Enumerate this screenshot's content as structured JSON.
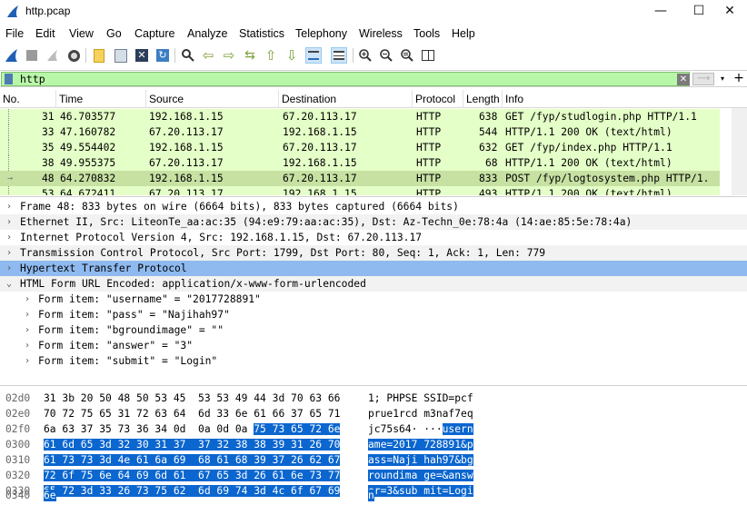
{
  "window": {
    "title": "http.pcap",
    "minimize": "—",
    "maximize": "☐",
    "close": "✕"
  },
  "menu": [
    "File",
    "Edit",
    "View",
    "Go",
    "Capture",
    "Analyze",
    "Statistics",
    "Telephony",
    "Wireless",
    "Tools",
    "Help"
  ],
  "toolbar": [
    "shark-fin-start-icon",
    "stop-capture-icon",
    "restart-capture-icon",
    "capture-options-icon",
    "open-file-icon",
    "save-file-icon",
    "close-file-icon",
    "reload-icon",
    "find-packet-icon",
    "go-back-icon",
    "go-forward-icon",
    "go-to-packet-icon",
    "go-first-icon",
    "go-last-icon",
    "auto-scroll-icon",
    "colorize-icon",
    "zoom-in-icon",
    "zoom-out-icon",
    "zoom-reset-icon",
    "resize-columns-icon"
  ],
  "filter": {
    "value": "http",
    "clear": "✕",
    "apply": "⟶",
    "dropdown": "▾",
    "add": "+"
  },
  "packet_list": {
    "columns": [
      "No.",
      "Time",
      "Source",
      "Destination",
      "Protocol",
      "Length",
      "Info"
    ],
    "rows": [
      {
        "no": "31",
        "time": "46.703577",
        "src": "192.168.1.15",
        "dst": "67.20.113.17",
        "proto": "HTTP",
        "len": "638",
        "info": "GET /fyp/studlogin.php HTTP/1.1"
      },
      {
        "no": "33",
        "time": "47.160782",
        "src": "67.20.113.17",
        "dst": "192.168.1.15",
        "proto": "HTTP",
        "len": "544",
        "info": "HTTP/1.1 200 OK  (text/html)"
      },
      {
        "no": "35",
        "time": "49.554402",
        "src": "192.168.1.15",
        "dst": "67.20.113.17",
        "proto": "HTTP",
        "len": "632",
        "info": "GET /fyp/index.php HTTP/1.1"
      },
      {
        "no": "38",
        "time": "49.955375",
        "src": "67.20.113.17",
        "dst": "192.168.1.15",
        "proto": "HTTP",
        "len": "68",
        "info": "HTTP/1.1 200 OK  (text/html)"
      },
      {
        "no": "48",
        "time": "64.270832",
        "src": "192.168.1.15",
        "dst": "67.20.113.17",
        "proto": "HTTP",
        "len": "833",
        "info": "POST /fyp/logtosystem.php HTTP/1."
      },
      {
        "no": "53",
        "time": "64.672411",
        "src": "67.20.113.17",
        "dst": "192.168.1.15",
        "proto": "HTTP",
        "len": "493",
        "info": "HTTP/1.1 200 OK  (text/html)"
      }
    ]
  },
  "details": {
    "frame": "Frame 48: 833 bytes on wire (6664 bits), 833 bytes captured (6664 bits)",
    "ethernet": "Ethernet II, Src: LiteonTe_aa:ac:35 (94:e9:79:aa:ac:35), Dst: Az-Techn_0e:78:4a (14:ae:85:5e:78:4a)",
    "ip": "Internet Protocol Version 4, Src: 192.168.1.15, Dst: 67.20.113.17",
    "tcp": "Transmission Control Protocol, Src Port: 1799, Dst Port: 80, Seq: 1, Ack: 1, Len: 779",
    "http": "Hypertext Transfer Protocol",
    "form": "HTML Form URL Encoded: application/x-www-form-urlencoded",
    "form_items": [
      "Form item: \"username\" = \"2017728891\"",
      "Form item: \"pass\" = \"Najihah97\"",
      "Form item: \"bgroundimage\" = \"\"",
      "Form item: \"answer\" = \"3\"",
      "Form item: \"submit\" = \"Login\""
    ]
  },
  "hex": [
    {
      "off": "02d0",
      "bytes": "31 3b 20 50 48 50 53 45  53 53 49 44 3d 70 63 66",
      "sel_bytes": "",
      "ascii": "1; PHPSE SSID=pcf",
      "sel_ascii": ""
    },
    {
      "off": "02e0",
      "bytes": "70 72 75 65 31 72 63 64  6d 33 6e 61 66 37 65 71",
      "sel_bytes": "",
      "ascii": "prue1rcd m3naf7eq",
      "sel_ascii": ""
    },
    {
      "off": "02f0",
      "bytes": "6a 63 37 35 73 36 34 0d  0a 0d 0a ",
      "sel_bytes": "75 73 65 72 6e",
      "ascii": "jc75s64· ···",
      "sel_ascii": "usern"
    },
    {
      "off": "0300",
      "bytes": "",
      "sel_bytes": "61 6d 65 3d 32 30 31 37  37 32 38 38 39 31 26 70",
      "ascii": "",
      "sel_ascii": "ame=2017 728891&p"
    },
    {
      "off": "0310",
      "bytes": "",
      "sel_bytes": "61 73 73 3d 4e 61 6a 69  68 61 68 39 37 26 62 67",
      "ascii": "",
      "sel_ascii": "ass=Naji hah97&bg"
    },
    {
      "off": "0320",
      "bytes": "",
      "sel_bytes": "72 6f 75 6e 64 69 6d 61  67 65 3d 26 61 6e 73 77",
      "ascii": "",
      "sel_ascii": "roundima ge=&answ"
    },
    {
      "off": "0330",
      "bytes": "",
      "sel_bytes": "65 72 3d 33 26 73 75 62  6d 69 74 3d 4c 6f 67 69",
      "ascii": "",
      "sel_ascii": "er=3&sub mit=Logi"
    },
    {
      "off": "0340",
      "bytes": "",
      "sel_bytes": "6e",
      "ascii": "",
      "sel_ascii": "n"
    }
  ]
}
